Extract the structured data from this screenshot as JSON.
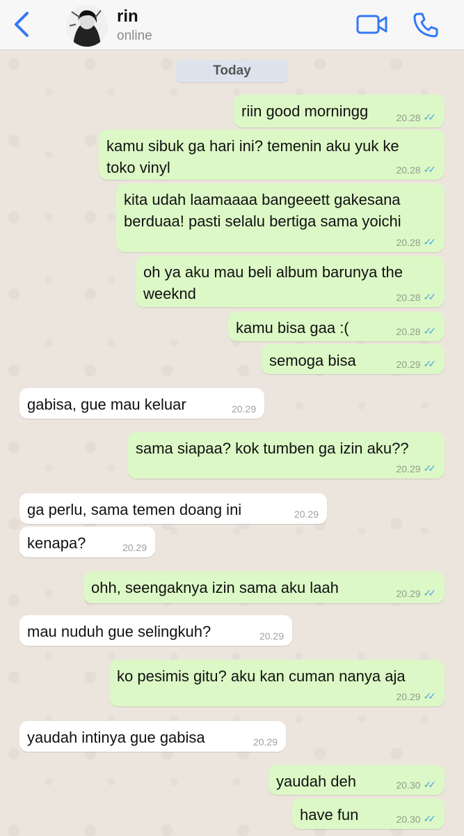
{
  "header": {
    "contact_name": "rin",
    "status": "online"
  },
  "chat": {
    "date_label": "Today",
    "messages": [
      {
        "dir": "out",
        "text": "riin good morningg",
        "time": "20.28"
      },
      {
        "dir": "out",
        "text": "kamu sibuk ga hari ini? temenin aku yuk ke\ntoko vinyl",
        "time": "20.28"
      },
      {
        "dir": "out",
        "text": "kita udah laamaaaa bangeeett gakesana\nberduaa! pasti selalu bertiga sama yoichi",
        "time": "20.28"
      },
      {
        "dir": "out",
        "text": "oh ya aku mau beli album barunya the\nweeknd",
        "time": "20.28"
      },
      {
        "dir": "out",
        "text": "kamu bisa gaa :(",
        "time": "20.28"
      },
      {
        "dir": "out",
        "text": "semoga bisa",
        "time": "20.29"
      },
      {
        "dir": "in",
        "text": "gabisa, gue mau keluar",
        "time": "20.29"
      },
      {
        "dir": "out",
        "text": "sama siapaa? kok tumben ga izin aku??",
        "time": "20.29"
      },
      {
        "dir": "in",
        "text": "ga perlu, sama temen doang ini",
        "time": "20.29"
      },
      {
        "dir": "in",
        "text": "kenapa?",
        "time": "20.29"
      },
      {
        "dir": "out",
        "text": "ohh, seengaknya izin sama aku laah",
        "time": "20.29"
      },
      {
        "dir": "in",
        "text": "mau nuduh gue selingkuh?",
        "time": "20.29"
      },
      {
        "dir": "out",
        "text": "ko pesimis gitu? aku kan cuman nanya aja",
        "time": "20.29"
      },
      {
        "dir": "in",
        "text": "yaudah intinya gue gabisa",
        "time": "20.29"
      },
      {
        "dir": "out",
        "text": "yaudah deh",
        "time": "20.30"
      },
      {
        "dir": "out",
        "text": "have fun",
        "time": "20.30"
      }
    ]
  },
  "icons": {
    "back": "chevron-left-icon",
    "video": "video-camera-icon",
    "call": "phone-icon",
    "read_receipt": "double-check-icon"
  },
  "colors": {
    "accent": "#3478f6",
    "outgoing_bubble": "#dcf8c6",
    "incoming_bubble": "#ffffff",
    "read_ticks": "#4fa7e0",
    "chat_background": "#ece5dd"
  }
}
